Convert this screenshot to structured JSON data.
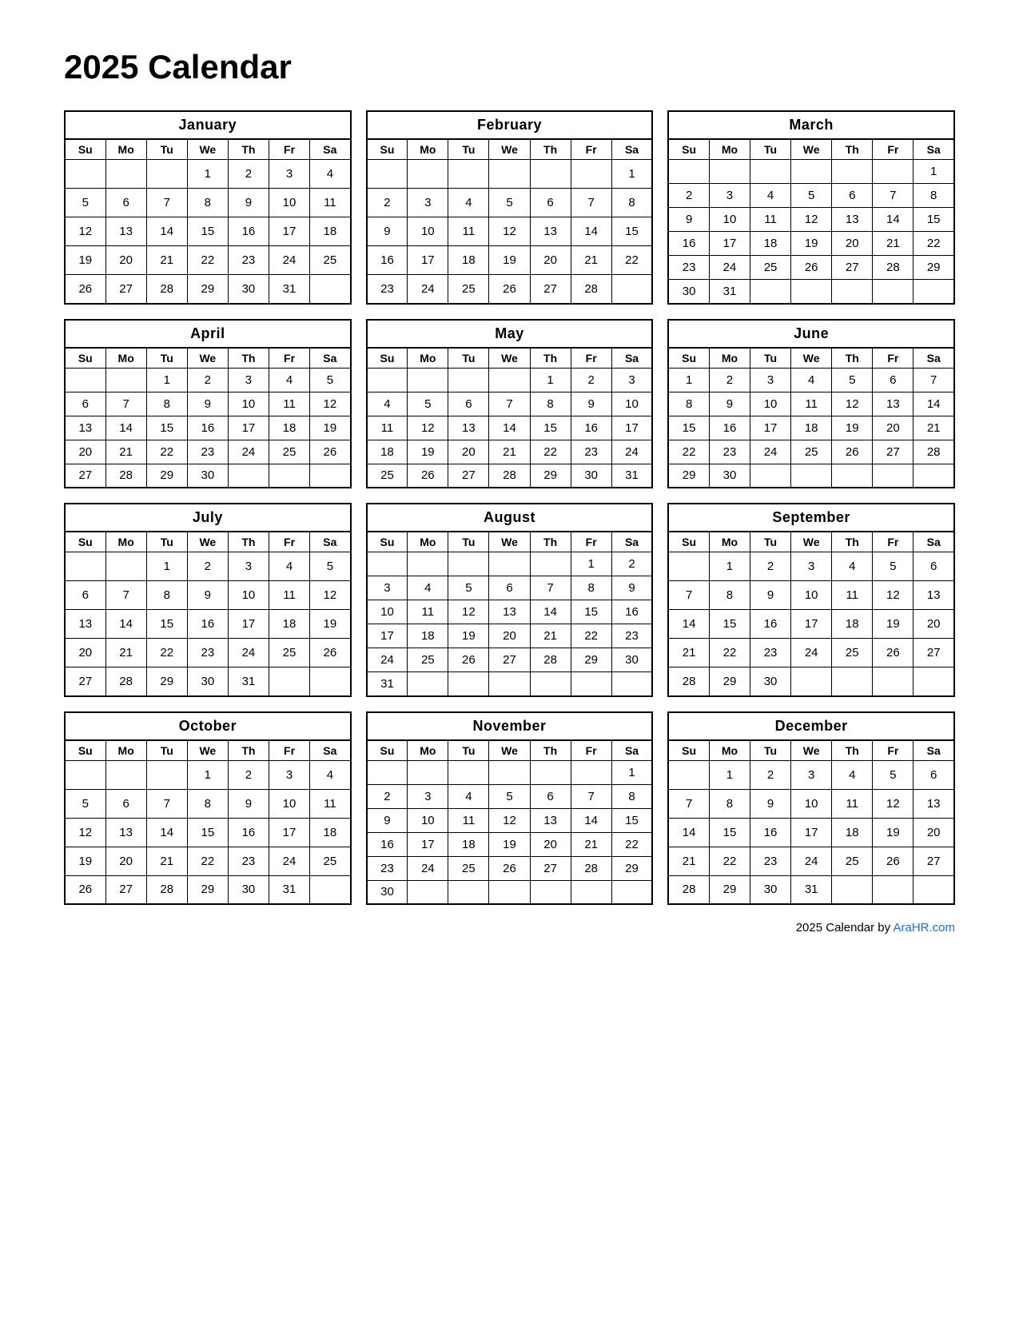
{
  "title": "2025 Calendar",
  "footer": {
    "text": "2025  Calendar by ",
    "link_text": "AraHR.com",
    "link_url": "AraHR.com"
  },
  "months": [
    {
      "name": "January",
      "weeks": [
        [
          "",
          "",
          "",
          "1",
          "2",
          "3",
          "4"
        ],
        [
          "5",
          "6",
          "7",
          "8",
          "9",
          "10",
          "11"
        ],
        [
          "12",
          "13",
          "14",
          "15",
          "16",
          "17",
          "18"
        ],
        [
          "19",
          "20",
          "21",
          "22",
          "23",
          "24",
          "25"
        ],
        [
          "26",
          "27",
          "28",
          "29",
          "30",
          "31",
          ""
        ]
      ]
    },
    {
      "name": "February",
      "weeks": [
        [
          "",
          "",
          "",
          "",
          "",
          "",
          "1"
        ],
        [
          "2",
          "3",
          "4",
          "5",
          "6",
          "7",
          "8"
        ],
        [
          "9",
          "10",
          "11",
          "12",
          "13",
          "14",
          "15"
        ],
        [
          "16",
          "17",
          "18",
          "19",
          "20",
          "21",
          "22"
        ],
        [
          "23",
          "24",
          "25",
          "26",
          "27",
          "28",
          ""
        ]
      ]
    },
    {
      "name": "March",
      "weeks": [
        [
          "",
          "",
          "",
          "",
          "",
          "",
          "1"
        ],
        [
          "2",
          "3",
          "4",
          "5",
          "6",
          "7",
          "8"
        ],
        [
          "9",
          "10",
          "11",
          "12",
          "13",
          "14",
          "15"
        ],
        [
          "16",
          "17",
          "18",
          "19",
          "20",
          "21",
          "22"
        ],
        [
          "23",
          "24",
          "25",
          "26",
          "27",
          "28",
          "29"
        ],
        [
          "30",
          "31",
          "",
          "",
          "",
          "",
          ""
        ]
      ]
    },
    {
      "name": "April",
      "weeks": [
        [
          "",
          "",
          "1",
          "2",
          "3",
          "4",
          "5"
        ],
        [
          "6",
          "7",
          "8",
          "9",
          "10",
          "11",
          "12"
        ],
        [
          "13",
          "14",
          "15",
          "16",
          "17",
          "18",
          "19"
        ],
        [
          "20",
          "21",
          "22",
          "23",
          "24",
          "25",
          "26"
        ],
        [
          "27",
          "28",
          "29",
          "30",
          "",
          "",
          ""
        ]
      ]
    },
    {
      "name": "May",
      "weeks": [
        [
          "",
          "",
          "",
          "",
          "1",
          "2",
          "3"
        ],
        [
          "4",
          "5",
          "6",
          "7",
          "8",
          "9",
          "10"
        ],
        [
          "11",
          "12",
          "13",
          "14",
          "15",
          "16",
          "17"
        ],
        [
          "18",
          "19",
          "20",
          "21",
          "22",
          "23",
          "24"
        ],
        [
          "25",
          "26",
          "27",
          "28",
          "29",
          "30",
          "31"
        ]
      ]
    },
    {
      "name": "June",
      "weeks": [
        [
          "1",
          "2",
          "3",
          "4",
          "5",
          "6",
          "7"
        ],
        [
          "8",
          "9",
          "10",
          "11",
          "12",
          "13",
          "14"
        ],
        [
          "15",
          "16",
          "17",
          "18",
          "19",
          "20",
          "21"
        ],
        [
          "22",
          "23",
          "24",
          "25",
          "26",
          "27",
          "28"
        ],
        [
          "29",
          "30",
          "",
          "",
          "",
          "",
          ""
        ]
      ]
    },
    {
      "name": "July",
      "weeks": [
        [
          "",
          "",
          "1",
          "2",
          "3",
          "4",
          "5"
        ],
        [
          "6",
          "7",
          "8",
          "9",
          "10",
          "11",
          "12"
        ],
        [
          "13",
          "14",
          "15",
          "16",
          "17",
          "18",
          "19"
        ],
        [
          "20",
          "21",
          "22",
          "23",
          "24",
          "25",
          "26"
        ],
        [
          "27",
          "28",
          "29",
          "30",
          "31",
          "",
          ""
        ]
      ]
    },
    {
      "name": "August",
      "weeks": [
        [
          "",
          "",
          "",
          "",
          "",
          "1",
          "2"
        ],
        [
          "3",
          "4",
          "5",
          "6",
          "7",
          "8",
          "9"
        ],
        [
          "10",
          "11",
          "12",
          "13",
          "14",
          "15",
          "16"
        ],
        [
          "17",
          "18",
          "19",
          "20",
          "21",
          "22",
          "23"
        ],
        [
          "24",
          "25",
          "26",
          "27",
          "28",
          "29",
          "30"
        ],
        [
          "31",
          "",
          "",
          "",
          "",
          "",
          ""
        ]
      ]
    },
    {
      "name": "September",
      "weeks": [
        [
          "",
          "1",
          "2",
          "3",
          "4",
          "5",
          "6"
        ],
        [
          "7",
          "8",
          "9",
          "10",
          "11",
          "12",
          "13"
        ],
        [
          "14",
          "15",
          "16",
          "17",
          "18",
          "19",
          "20"
        ],
        [
          "21",
          "22",
          "23",
          "24",
          "25",
          "26",
          "27"
        ],
        [
          "28",
          "29",
          "30",
          "",
          "",
          "",
          ""
        ]
      ]
    },
    {
      "name": "October",
      "weeks": [
        [
          "",
          "",
          "",
          "1",
          "2",
          "3",
          "4"
        ],
        [
          "5",
          "6",
          "7",
          "8",
          "9",
          "10",
          "11"
        ],
        [
          "12",
          "13",
          "14",
          "15",
          "16",
          "17",
          "18"
        ],
        [
          "19",
          "20",
          "21",
          "22",
          "23",
          "24",
          "25"
        ],
        [
          "26",
          "27",
          "28",
          "29",
          "30",
          "31",
          ""
        ]
      ]
    },
    {
      "name": "November",
      "weeks": [
        [
          "",
          "",
          "",
          "",
          "",
          "",
          "1"
        ],
        [
          "2",
          "3",
          "4",
          "5",
          "6",
          "7",
          "8"
        ],
        [
          "9",
          "10",
          "11",
          "12",
          "13",
          "14",
          "15"
        ],
        [
          "16",
          "17",
          "18",
          "19",
          "20",
          "21",
          "22"
        ],
        [
          "23",
          "24",
          "25",
          "26",
          "27",
          "28",
          "29"
        ],
        [
          "30",
          "",
          "",
          "",
          "",
          "",
          ""
        ]
      ]
    },
    {
      "name": "December",
      "weeks": [
        [
          "",
          "1",
          "2",
          "3",
          "4",
          "5",
          "6"
        ],
        [
          "7",
          "8",
          "9",
          "10",
          "11",
          "12",
          "13"
        ],
        [
          "14",
          "15",
          "16",
          "17",
          "18",
          "19",
          "20"
        ],
        [
          "21",
          "22",
          "23",
          "24",
          "25",
          "26",
          "27"
        ],
        [
          "28",
          "29",
          "30",
          "31",
          "",
          "",
          ""
        ]
      ]
    }
  ],
  "day_headers": [
    "Su",
    "Mo",
    "Tu",
    "We",
    "Th",
    "Fr",
    "Sa"
  ]
}
